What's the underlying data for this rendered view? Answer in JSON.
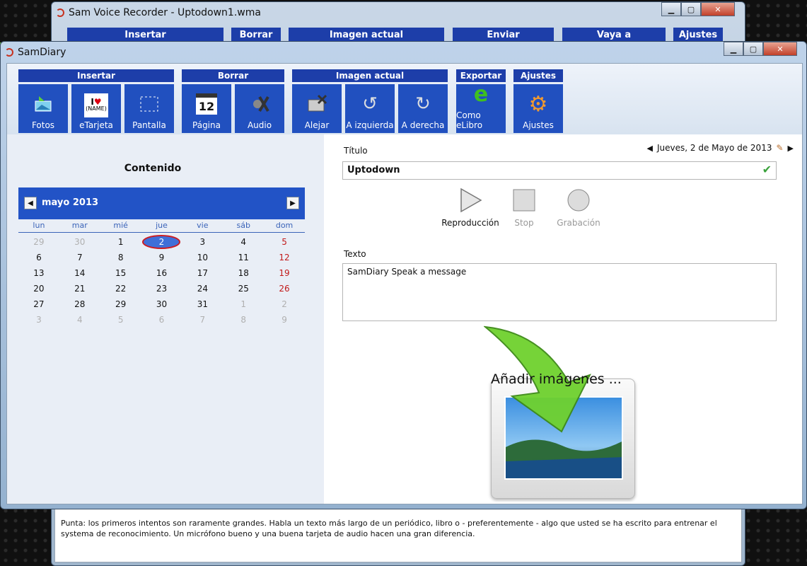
{
  "back_window": {
    "title": "Sam Voice Recorder - Uptodown1.wma",
    "menu": [
      "Insertar",
      "Borrar",
      "Imagen actual",
      "Enviar",
      "Vaya a",
      "Ajustes"
    ],
    "tip": "Punta: los primeros intentos son raramente grandes. Habla un texto más largo de un periódico, libro o - preferentemente - algo que usted se ha escrito para entrenar el systema de reconocimiento. Un micrófono bueno y una buena tarjeta de audio hacen una gran diferencia."
  },
  "window": {
    "title": "SamDiary",
    "controls": [
      "minimize",
      "maximize",
      "close"
    ]
  },
  "ribbon": {
    "insertar": {
      "label": "Insertar",
      "buttons": [
        {
          "label": "Fotos",
          "icon": "photos-import-icon"
        },
        {
          "label": "eTarjeta",
          "icon": "i-love-name-card-icon",
          "icon_text": "(NAME)"
        },
        {
          "label": "Pantalla",
          "icon": "screen-capture-icon"
        }
      ]
    },
    "borrar": {
      "label": "Borrar",
      "buttons": [
        {
          "label": "Página",
          "icon": "calendar-page-delete-icon",
          "icon_text": "12"
        },
        {
          "label": "Audio",
          "icon": "audio-delete-icon"
        }
      ]
    },
    "imagen": {
      "label": "Imagen actual",
      "buttons": [
        {
          "label": "Alejar",
          "icon": "image-remove-icon"
        },
        {
          "label": "A izquierda",
          "icon": "rotate-left-icon"
        },
        {
          "label": "A derecha",
          "icon": "rotate-right-icon"
        }
      ]
    },
    "exportar": {
      "label": "Exportar",
      "buttons": [
        {
          "label": "Como eLibro",
          "icon": "ebook-export-icon"
        }
      ]
    },
    "ajustes": {
      "label": "Ajustes",
      "buttons": [
        {
          "label": "Ajustes",
          "icon": "gear-icon"
        }
      ]
    }
  },
  "left": {
    "title": "Contenido",
    "calendar": {
      "month": "mayo 2013",
      "weekdays": [
        "lun",
        "mar",
        "mié",
        "jue",
        "vie",
        "sáb",
        "dom"
      ],
      "weeks": [
        [
          "29",
          "30",
          "1",
          "2",
          "3",
          "4",
          "5"
        ],
        [
          "6",
          "7",
          "8",
          "9",
          "10",
          "11",
          "12"
        ],
        [
          "13",
          "14",
          "15",
          "16",
          "17",
          "18",
          "19"
        ],
        [
          "20",
          "21",
          "22",
          "23",
          "24",
          "25",
          "26"
        ],
        [
          "27",
          "28",
          "29",
          "30",
          "31",
          "1",
          "2"
        ],
        [
          "3",
          "4",
          "5",
          "6",
          "7",
          "8",
          "9"
        ]
      ],
      "selected": "2"
    }
  },
  "entry": {
    "date": "Jueves, 2 de Mayo de 2013",
    "title_label": "Título",
    "title_value": "Uptodown",
    "player": [
      {
        "label": "Reproducción",
        "icon": "play-icon",
        "enabled": true
      },
      {
        "label": "Stop",
        "icon": "stop-icon",
        "enabled": false
      },
      {
        "label": "Grabación",
        "icon": "record-icon",
        "enabled": false
      }
    ],
    "text_label": "Texto",
    "text_value": "SamDiary Speak a message",
    "add_images": "Añadir imágenes ..."
  },
  "colors": {
    "ribbon_blue": "#2150bf",
    "header_blue": "#1d3ea9",
    "calendar_blue": "#2253c6",
    "sunday_red": "#c21a1a",
    "check_green": "#3aa23c"
  }
}
